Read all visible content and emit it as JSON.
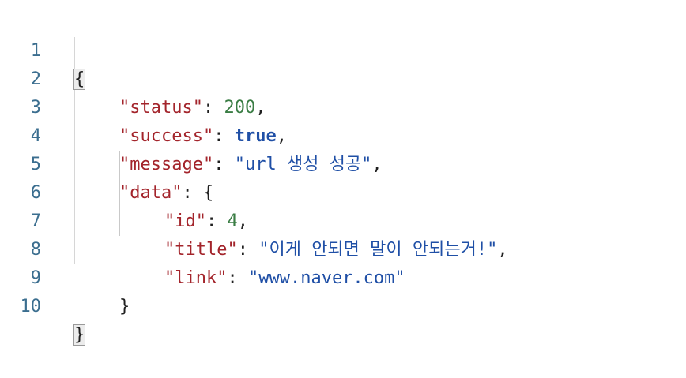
{
  "editor": {
    "line_numbers": [
      "1",
      "2",
      "3",
      "4",
      "5",
      "6",
      "7",
      "8",
      "9",
      "10"
    ],
    "lines": {
      "l1": {
        "open_brace": "{"
      },
      "l2": {
        "key": "\"status\"",
        "colon": ": ",
        "value": "200",
        "comma": ","
      },
      "l3": {
        "key": "\"success\"",
        "colon": ": ",
        "value": "true",
        "comma": ","
      },
      "l4": {
        "key": "\"message\"",
        "colon": ": ",
        "value": "\"url 생성 성공\"",
        "comma": ","
      },
      "l5": {
        "key": "\"data\"",
        "colon": ": ",
        "value": "{"
      },
      "l6": {
        "key": "\"id\"",
        "colon": ": ",
        "value": "4",
        "comma": ","
      },
      "l7": {
        "key": "\"title\"",
        "colon": ": ",
        "value": "\"이게 안되면 말이 안되는거!\"",
        "comma": ","
      },
      "l8": {
        "key": "\"link\"",
        "colon": ": ",
        "value": "\"www.naver.com\""
      },
      "l9": {
        "close_brace": "}"
      },
      "l10": {
        "close_brace": "}"
      }
    }
  }
}
